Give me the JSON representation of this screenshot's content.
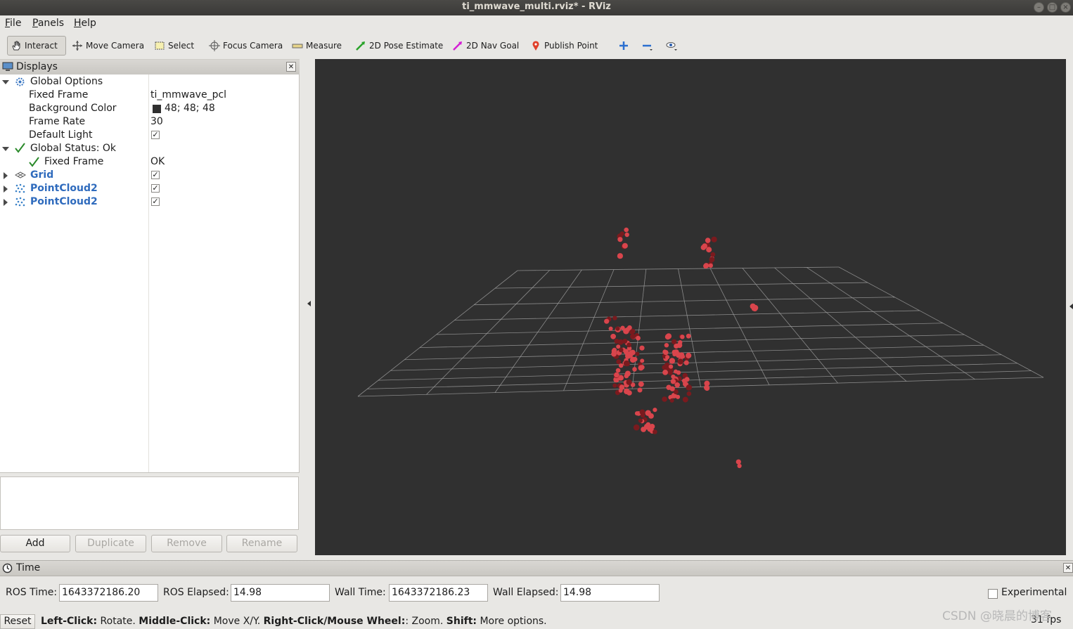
{
  "window": {
    "title": "ti_mmwave_multi.rviz* - RViz"
  },
  "menubar": {
    "items": [
      "File",
      "Panels",
      "Help"
    ]
  },
  "toolbar": {
    "interact": "Interact",
    "move_camera": "Move Camera",
    "select": "Select",
    "focus_camera": "Focus Camera",
    "measure": "Measure",
    "pose_estimate": "2D Pose Estimate",
    "nav_goal": "2D Nav Goal",
    "publish_point": "Publish Point"
  },
  "displays": {
    "title": "Displays",
    "global_options": "Global Options",
    "fixed_frame_label": "Fixed Frame",
    "fixed_frame_value": "ti_mmwave_pcl",
    "bg_color_label": "Background Color",
    "bg_color_value": "48; 48; 48",
    "bg_color_hex": "#303030",
    "frame_rate_label": "Frame Rate",
    "frame_rate_value": "30",
    "default_light_label": "Default Light",
    "global_status": "Global Status: Ok",
    "status_fixed_frame_label": "Fixed Frame",
    "status_fixed_frame_value": "OK",
    "grid": "Grid",
    "pointcloud_a": "PointCloud2",
    "pointcloud_b": "PointCloud2",
    "checked_mark": "✓"
  },
  "buttons": {
    "add": "Add",
    "duplicate": "Duplicate",
    "remove": "Remove",
    "rename": "Rename"
  },
  "time": {
    "title": "Time",
    "ros_time_label": "ROS Time:",
    "ros_time_value": "1643372186.20",
    "ros_elapsed_label": "ROS Elapsed:",
    "ros_elapsed_value": "14.98",
    "wall_time_label": "Wall Time:",
    "wall_time_value": "1643372186.23",
    "wall_elapsed_label": "Wall Elapsed:",
    "wall_elapsed_value": "14.98",
    "experimental_label": "Experimental"
  },
  "status": {
    "reset": "Reset",
    "left_click_key": "Left-Click:",
    "left_click_text": "Rotate.",
    "middle_click_key": "Middle-Click:",
    "middle_click_text": "Move X/Y.",
    "right_click_key": "Right-Click/Mouse Wheel:",
    "right_click_text": ": Zoom.",
    "shift_key": "Shift:",
    "shift_text": "More options.",
    "fps": "31 fps"
  },
  "watermark": "CSDN @晓晨的博客",
  "colors": {
    "viewport_bg": "#303030",
    "grid_line": "#a0a0a0",
    "point": "#d9454c",
    "point_dark": "#7a1a1e"
  }
}
